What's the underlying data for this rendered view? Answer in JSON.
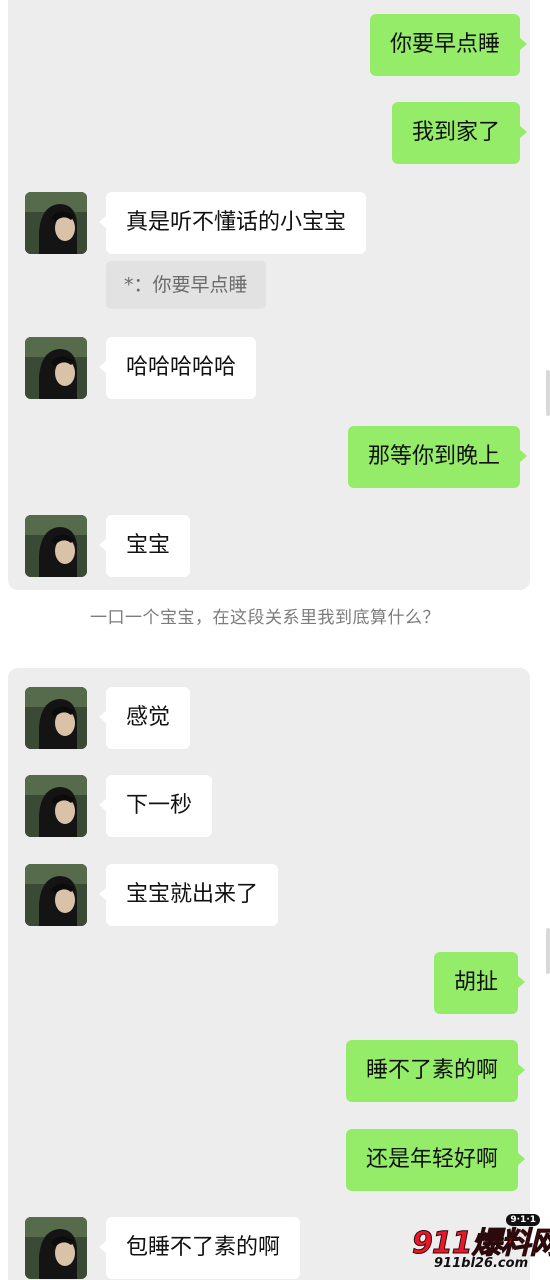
{
  "colors": {
    "outgoing_bubble": "#95ec69",
    "incoming_bubble": "#ffffff",
    "panel_background": "#ededed",
    "quote_background": "#e2e2e2",
    "watermark_red": "#e8182a"
  },
  "chat1": {
    "messages": [
      {
        "side": "out",
        "text": "你要早点睡"
      },
      {
        "side": "out",
        "text": "我到家了"
      },
      {
        "side": "in",
        "text": "真是听不懂话的小宝宝",
        "avatar": "avatar-photo"
      },
      {
        "side": "in",
        "text": "哈哈哈哈哈",
        "avatar": "avatar-photo"
      },
      {
        "side": "out",
        "text": "那等你到晚上"
      },
      {
        "side": "in",
        "text": "宝宝",
        "avatar": "avatar-photo"
      }
    ],
    "quote": "*：你要早点睡"
  },
  "caption": "一口一个宝宝，在这段关系里我到底算什么？",
  "chat2": {
    "messages": [
      {
        "side": "in",
        "text": "感觉",
        "avatar": "avatar-photo"
      },
      {
        "side": "in",
        "text": "下一秒",
        "avatar": "avatar-photo"
      },
      {
        "side": "in",
        "text": "宝宝就出来了",
        "avatar": "avatar-photo"
      },
      {
        "side": "out",
        "text": "胡扯"
      },
      {
        "side": "out",
        "text": "睡不了素的啊"
      },
      {
        "side": "out",
        "text": "还是年轻好啊"
      },
      {
        "side": "in",
        "text": "包睡不了素的啊",
        "avatar": "avatar-photo"
      }
    ]
  },
  "watermark": {
    "main": "911爆料网",
    "badge": "9·1·1",
    "url": "911bl26.com"
  }
}
